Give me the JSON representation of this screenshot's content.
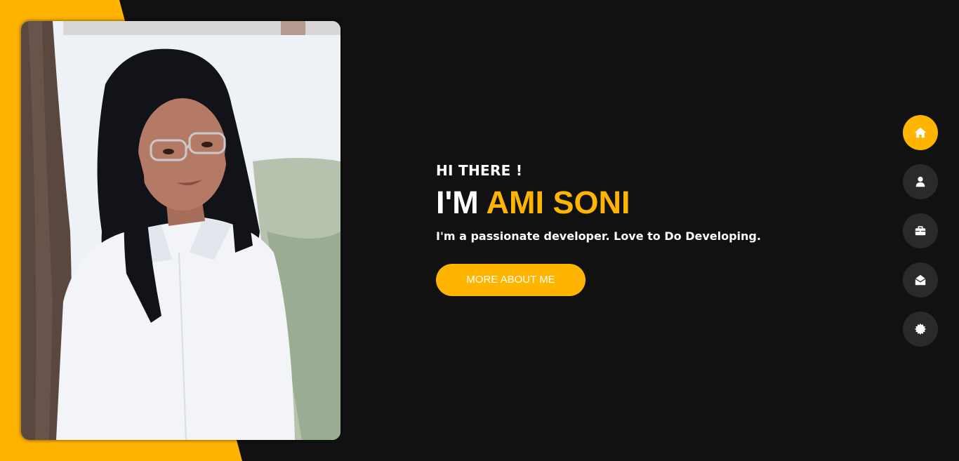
{
  "hero": {
    "greeting": "HI THERE !",
    "headline_prefix": "I'M ",
    "headline_name": "AMI SONI",
    "tagline": "I'm a passionate developer. Love to Do Developing.",
    "cta_label": "MORE ABOUT ME"
  },
  "nav": {
    "items": [
      {
        "icon": "home-icon",
        "active": true
      },
      {
        "icon": "user-icon",
        "active": false
      },
      {
        "icon": "briefcase-icon",
        "active": false
      },
      {
        "icon": "envelope-open-icon",
        "active": false
      },
      {
        "icon": "gear-icon",
        "active": false
      }
    ]
  },
  "colors": {
    "accent": "#ffb400",
    "background": "#111111",
    "nav_button": "#2b2a2a"
  }
}
